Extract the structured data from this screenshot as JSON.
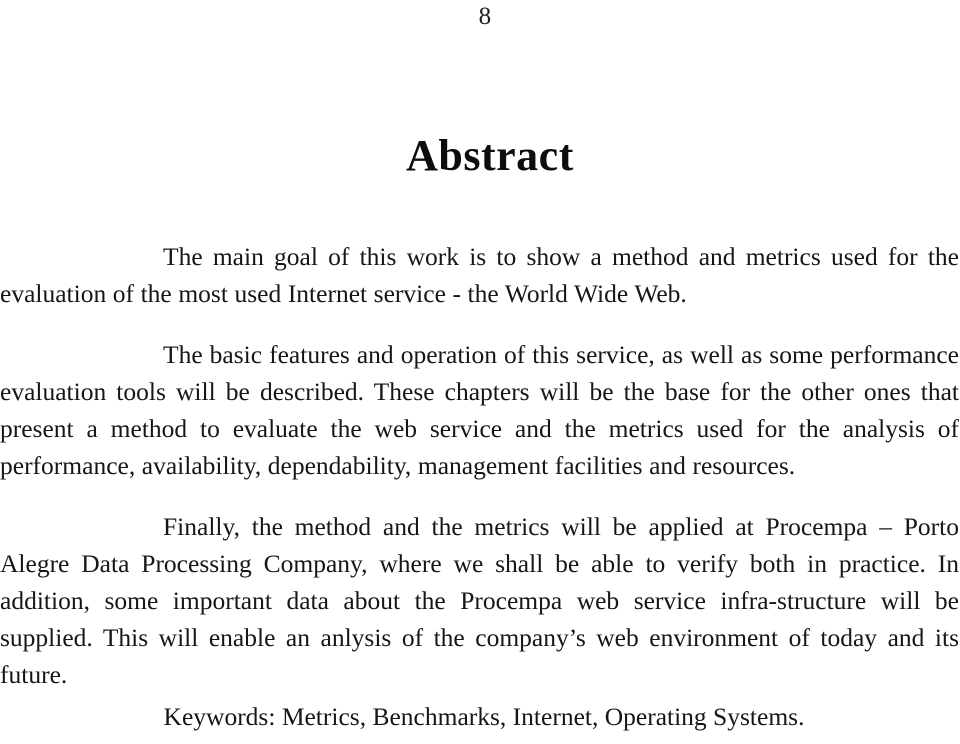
{
  "document": {
    "page_number": "8",
    "heading": "Abstract",
    "paragraphs": [
      "The main goal of this work is to show a method and metrics used for the evaluation of the most used Internet service - the World Wide Web.",
      "The basic features and operation of this service, as well as some performance evaluation tools will be described. These chapters will be the base for the other ones that present a method to evaluate the web service and the metrics used for the analysis of performance, availability, dependability, management facilities and resources.",
      "Finally, the method and the metrics will be applied at Procempa – Porto Alegre Data Processing Company, where we shall be able to verify both in practice. In addition, some important data about the Procempa web service infra-structure will be supplied. This will enable an anlysis of the company’s web environment of today and its future."
    ],
    "keywords_line": "Keywords: Metrics, Benchmarks, Internet, Operating Systems.",
    "colors": {
      "page_background": "#ffffff",
      "body_text": "#161616",
      "heading_text": "#0d0d0d"
    }
  }
}
